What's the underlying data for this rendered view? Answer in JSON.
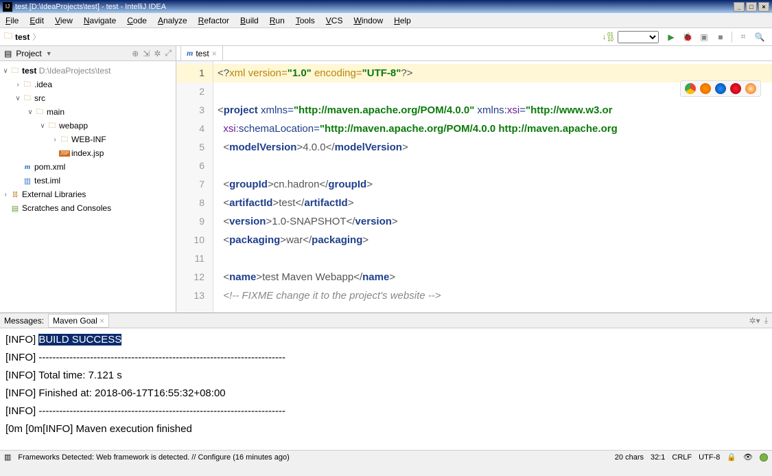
{
  "title": "test [D:\\IdeaProjects\\test] - test - IntelliJ IDEA",
  "menu": [
    "File",
    "Edit",
    "View",
    "Navigate",
    "Code",
    "Analyze",
    "Refactor",
    "Build",
    "Run",
    "Tools",
    "VCS",
    "Window",
    "Help"
  ],
  "breadcrumb": {
    "project": "test"
  },
  "toolbar_right": {
    "download_01_10": "01\n10"
  },
  "project_pane": {
    "title": "Project",
    "tree": {
      "root": {
        "name": "test",
        "path": "D:\\IdeaProjects\\test"
      },
      "idea": ".idea",
      "src": "src",
      "main": "main",
      "webapp": "webapp",
      "webinf": "WEB-INF",
      "indexjsp": "index.jsp",
      "pom": "pom.xml",
      "iml": "test.iml",
      "ext": "External Libraries",
      "scratches": "Scratches and Consoles"
    }
  },
  "editor": {
    "tab": "test",
    "lines": [
      {
        "n": 1,
        "cur": true,
        "segs": [
          {
            "c": "t-brk",
            "t": "<?"
          },
          {
            "c": "t-proc",
            "t": "xml version="
          },
          {
            "c": "t-str",
            "t": "\"1.0\""
          },
          {
            "c": "t-proc",
            "t": " encoding="
          },
          {
            "c": "t-str",
            "t": "\"UTF-8\""
          },
          {
            "c": "t-brk",
            "t": "?>"
          }
        ]
      },
      {
        "n": 2,
        "segs": []
      },
      {
        "n": 3,
        "segs": [
          {
            "c": "t-brk",
            "t": "<"
          },
          {
            "c": "t-tag",
            "t": "project"
          },
          {
            "c": "",
            "t": " "
          },
          {
            "c": "t-attr",
            "t": "xmlns="
          },
          {
            "c": "t-str",
            "t": "\"http://maven.apache.org/POM/4.0.0\""
          },
          {
            "c": "",
            "t": " "
          },
          {
            "c": "t-attr",
            "t": "xmlns:"
          },
          {
            "c": "t-nsattr",
            "t": "xsi"
          },
          {
            "c": "t-attr",
            "t": "="
          },
          {
            "c": "t-str",
            "t": "\"http://www.w3.or"
          }
        ]
      },
      {
        "n": 4,
        "segs": [
          {
            "c": "",
            "t": "  "
          },
          {
            "c": "t-nsattr",
            "t": "xsi"
          },
          {
            "c": "t-attr",
            "t": ":schemaLocation="
          },
          {
            "c": "t-str",
            "t": "\"http://maven.apache.org/POM/4.0.0 http://maven.apache.org"
          }
        ]
      },
      {
        "n": 5,
        "segs": [
          {
            "c": "",
            "t": "  "
          },
          {
            "c": "t-brk",
            "t": "<"
          },
          {
            "c": "t-tag",
            "t": "modelVersion"
          },
          {
            "c": "t-brk",
            "t": ">"
          },
          {
            "c": "t-txt",
            "t": "4.0.0"
          },
          {
            "c": "t-brk",
            "t": "</"
          },
          {
            "c": "t-tag",
            "t": "modelVersion"
          },
          {
            "c": "t-brk",
            "t": ">"
          }
        ]
      },
      {
        "n": 6,
        "segs": []
      },
      {
        "n": 7,
        "segs": [
          {
            "c": "",
            "t": "  "
          },
          {
            "c": "t-brk",
            "t": "<"
          },
          {
            "c": "t-tag",
            "t": "groupId"
          },
          {
            "c": "t-brk",
            "t": ">"
          },
          {
            "c": "t-txt",
            "t": "cn.hadron"
          },
          {
            "c": "t-brk",
            "t": "</"
          },
          {
            "c": "t-tag",
            "t": "groupId"
          },
          {
            "c": "t-brk",
            "t": ">"
          }
        ]
      },
      {
        "n": 8,
        "segs": [
          {
            "c": "",
            "t": "  "
          },
          {
            "c": "t-brk",
            "t": "<"
          },
          {
            "c": "t-tag",
            "t": "artifactId"
          },
          {
            "c": "t-brk",
            "t": ">"
          },
          {
            "c": "t-txt",
            "t": "test"
          },
          {
            "c": "t-brk",
            "t": "</"
          },
          {
            "c": "t-tag",
            "t": "artifactId"
          },
          {
            "c": "t-brk",
            "t": ">"
          }
        ]
      },
      {
        "n": 9,
        "segs": [
          {
            "c": "",
            "t": "  "
          },
          {
            "c": "t-brk",
            "t": "<"
          },
          {
            "c": "t-tag",
            "t": "version"
          },
          {
            "c": "t-brk",
            "t": ">"
          },
          {
            "c": "t-txt",
            "t": "1.0-SNAPSHOT"
          },
          {
            "c": "t-brk",
            "t": "</"
          },
          {
            "c": "t-tag",
            "t": "version"
          },
          {
            "c": "t-brk",
            "t": ">"
          }
        ]
      },
      {
        "n": 10,
        "segs": [
          {
            "c": "",
            "t": "  "
          },
          {
            "c": "t-brk",
            "t": "<"
          },
          {
            "c": "t-tag",
            "t": "packaging"
          },
          {
            "c": "t-brk",
            "t": ">"
          },
          {
            "c": "t-txt",
            "t": "war"
          },
          {
            "c": "t-brk",
            "t": "</"
          },
          {
            "c": "t-tag",
            "t": "packaging"
          },
          {
            "c": "t-brk",
            "t": ">"
          }
        ]
      },
      {
        "n": 11,
        "segs": []
      },
      {
        "n": 12,
        "segs": [
          {
            "c": "",
            "t": "  "
          },
          {
            "c": "t-brk",
            "t": "<"
          },
          {
            "c": "t-tag",
            "t": "name"
          },
          {
            "c": "t-brk",
            "t": ">"
          },
          {
            "c": "t-txt",
            "t": "test Maven Webapp"
          },
          {
            "c": "t-brk",
            "t": "</"
          },
          {
            "c": "t-tag",
            "t": "name"
          },
          {
            "c": "t-brk",
            "t": ">"
          }
        ]
      },
      {
        "n": 13,
        "segs": [
          {
            "c": "",
            "t": "  "
          },
          {
            "c": "t-com",
            "t": "<!-- FIXME change it to the project's website -->"
          }
        ]
      }
    ]
  },
  "messages": {
    "title": "Messages:",
    "tab": "Maven Goal",
    "lines": [
      {
        "pre": "[INFO] ",
        "hi": "BUILD SUCCESS",
        "rest": ""
      },
      {
        "pre": "[INFO] ",
        "hi": "",
        "rest": "------------------------------------------------------------------------"
      },
      {
        "pre": "[INFO] ",
        "hi": "",
        "rest": "Total time: 7.121 s"
      },
      {
        "pre": "[INFO] ",
        "hi": "",
        "rest": "Finished at: 2018-06-17T16:55:32+08:00"
      },
      {
        "pre": "[INFO] ",
        "hi": "",
        "rest": "------------------------------------------------------------------------"
      },
      {
        "pre": "",
        "hi": "",
        "rest": "[0m [0m[INFO] Maven execution finished"
      }
    ]
  },
  "status": {
    "framework_msg": "Frameworks Detected: Web framework is detected. // Configure (16 minutes ago)",
    "chars": "20 chars",
    "pos": "32:1",
    "lf": "CRLF",
    "enc": "UTF-8"
  }
}
